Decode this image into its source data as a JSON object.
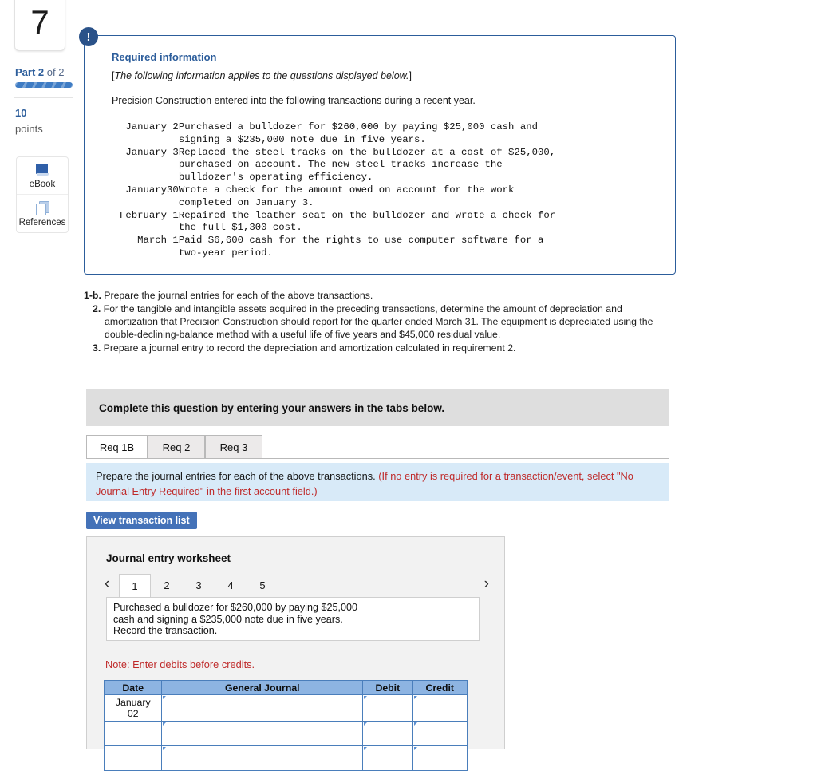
{
  "rail": {
    "question_number": "7",
    "part_label_bold": "Part 2",
    "part_label_rest": " of 2",
    "points_number": "10",
    "points_word": "points",
    "tools": [
      {
        "label": "eBook",
        "icon": "book-icon"
      },
      {
        "label": "References",
        "icon": "copy-pages-icon"
      }
    ]
  },
  "info_panel": {
    "badge": "!",
    "title": "Required information",
    "subtitle_open": "[",
    "subtitle_italic": "The following information applies to the questions displayed below.",
    "subtitle_close": "]",
    "intro": "Precision Construction entered into the following transactions during a recent year.",
    "transactions": [
      {
        "month": "January",
        "day": "2",
        "lines": [
          "Purchased a bulldozer for $260,000 by paying $25,000 cash and",
          "signing a $235,000 note due in five years."
        ]
      },
      {
        "month": "January",
        "day": "3",
        "lines": [
          "Replaced the steel tracks on the bulldozer at a cost of $25,000,",
          "purchased on account. The new steel tracks increase the",
          "bulldozer's operating efficiency."
        ]
      },
      {
        "month": "January",
        "day": "30",
        "lines": [
          "Wrote a check for the amount owed on account for the work",
          "completed on January 3."
        ]
      },
      {
        "month": "February",
        "day": "1",
        "lines": [
          "Repaired the leather seat on the bulldozer and wrote a check for",
          "the full $1,300 cost."
        ]
      },
      {
        "month": "March",
        "day": "1",
        "lines": [
          "Paid $6,600 cash for the rights to use computer software for a",
          "two-year period."
        ]
      }
    ]
  },
  "requirements": [
    {
      "number": "1-b.",
      "text": " Prepare the journal entries for each of the above transactions."
    },
    {
      "number": "2.",
      "text": " For the tangible and intangible assets acquired in the preceding transactions, determine the amount of depreciation and amortization that Precision Construction should report for the quarter ended March 31. The equipment is depreciated using the double-declining-balance method with a useful life of five years and $45,000 residual value."
    },
    {
      "number": "3.",
      "text": " Prepare a journal entry to record the depreciation and amortization calculated in requirement 2."
    }
  ],
  "complete_bar": {
    "text": "Complete this question by entering your answers in the tabs below."
  },
  "tabs": [
    {
      "label": "Req 1B",
      "active": true
    },
    {
      "label": "Req 2",
      "active": false
    },
    {
      "label": "Req 3",
      "active": false
    }
  ],
  "banner": {
    "black_text": "Prepare the journal entries for each of the above transactions. ",
    "red_text": "(If no entry is required for a transaction/event, select \"No Journal Entry Required\" in the first account field.)",
    "red_color": "#bf2a2a"
  },
  "view_button": {
    "label": "View transaction list"
  },
  "worksheet": {
    "title": "Journal entry worksheet",
    "prev_icon": "chevron-left-icon",
    "next_icon": "chevron-right-icon",
    "pages": [
      "1",
      "2",
      "3",
      "4",
      "5"
    ],
    "active_page": "1",
    "description_lines": [
      "Purchased a bulldozer for $260,000 by paying $25,000",
      "cash and signing a $235,000 note due in five years.",
      "Record the transaction."
    ],
    "note": "Note: Enter debits before credits."
  },
  "journal_table": {
    "headers": [
      "Date",
      "General Journal",
      "Debit",
      "Credit"
    ],
    "rows": [
      {
        "date": "January 02",
        "general_journal": "",
        "debit": "",
        "credit": ""
      },
      {
        "date": "",
        "general_journal": "",
        "debit": "",
        "credit": ""
      },
      {
        "date": "",
        "general_journal": "",
        "debit": "",
        "credit": ""
      }
    ],
    "header_color": "#8db4e2"
  }
}
